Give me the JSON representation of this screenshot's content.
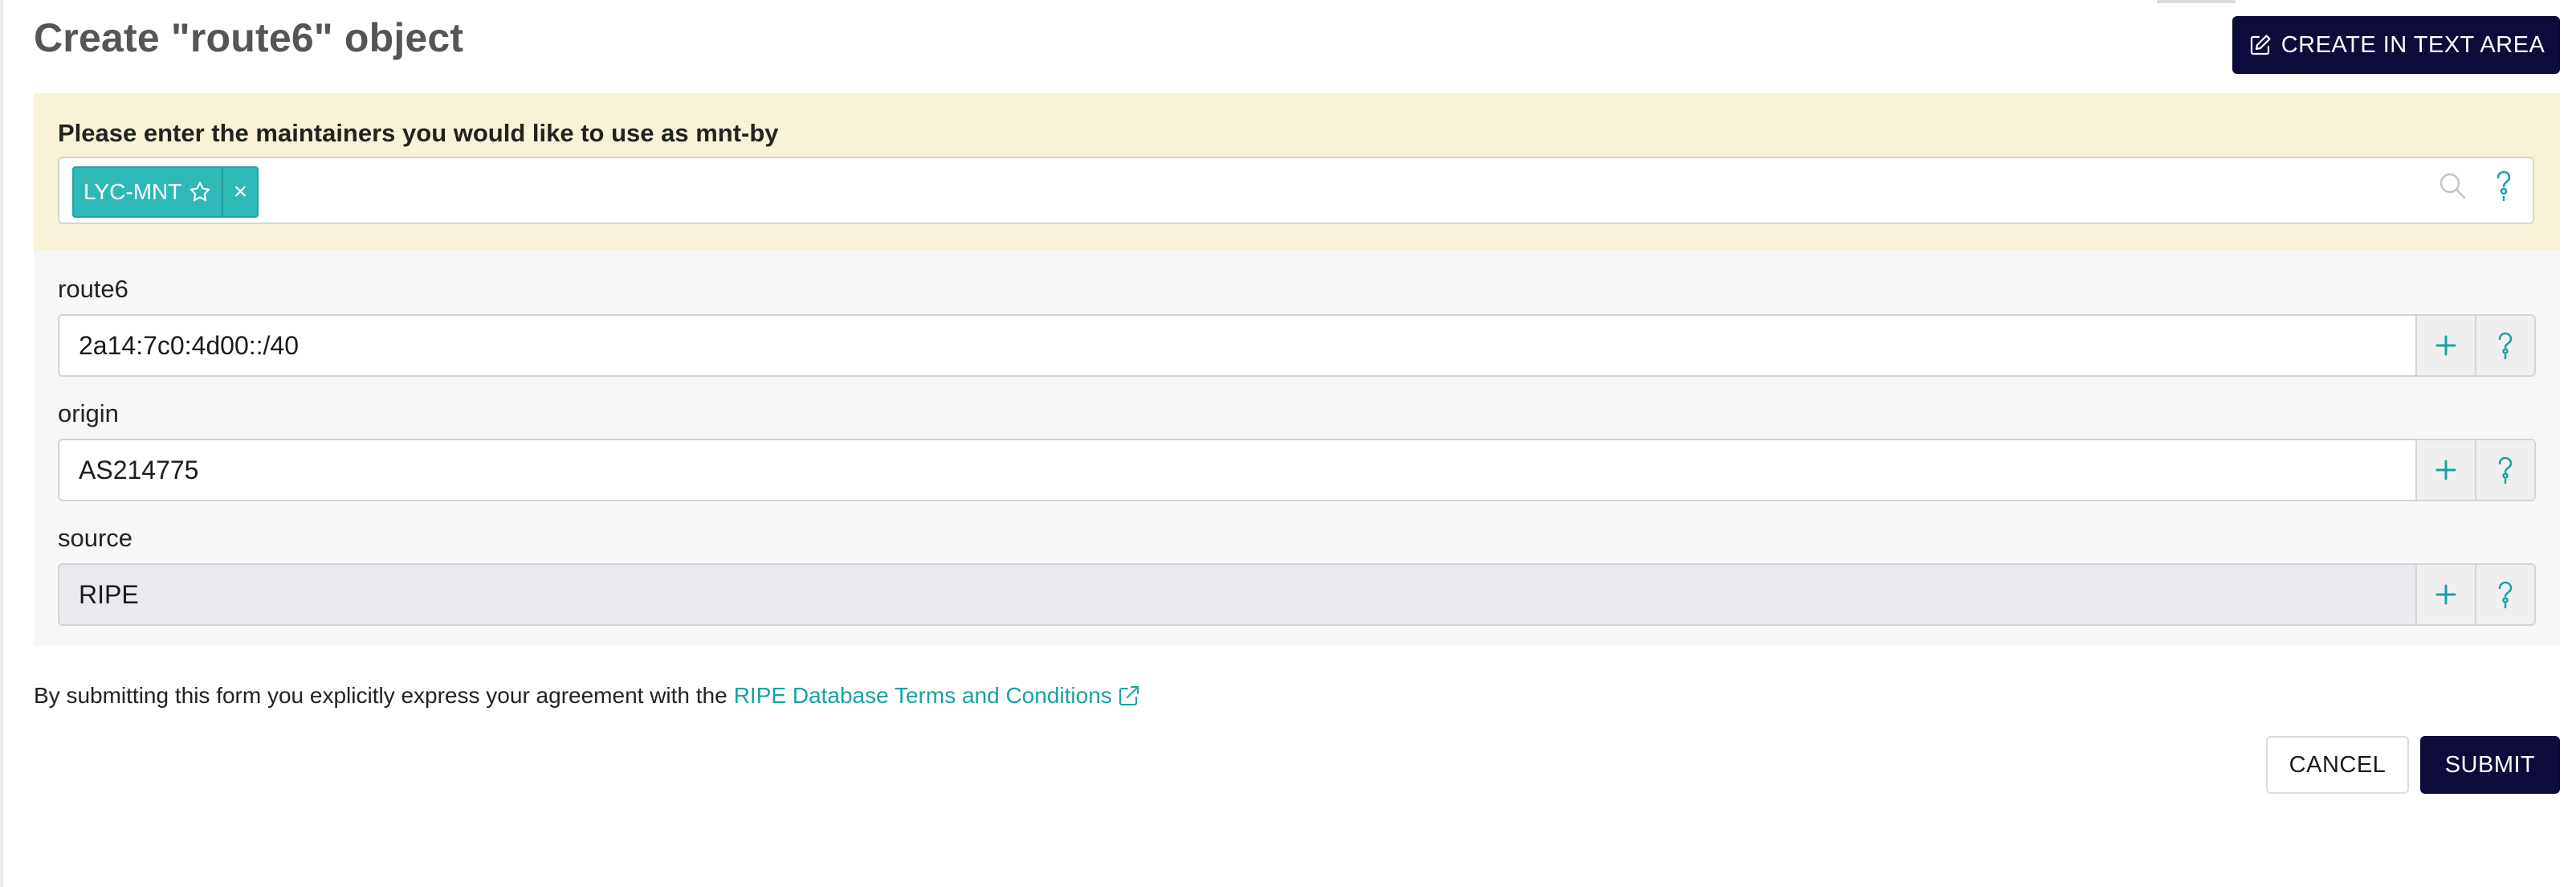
{
  "header": {
    "title": "Create \"route6\" object",
    "text_area_button_label": "CREATE IN TEXT AREA"
  },
  "maintainers": {
    "label": "Please enter the maintainers you would like to use as mnt-by",
    "selected": [
      {
        "name": "LYC-MNT",
        "remove_label": "×"
      }
    ]
  },
  "attributes": [
    {
      "label": "route6",
      "value": "2a14:7c0:4d00::/40",
      "disabled": false
    },
    {
      "label": "origin",
      "value": "AS214775",
      "disabled": false
    },
    {
      "label": "source",
      "value": "RIPE",
      "disabled": true
    }
  ],
  "footer": {
    "agreement_text": "By submitting this form you explicitly express your agreement with the",
    "terms_link_text": "RIPE Database Terms and Conditions",
    "cancel_label": "CANCEL",
    "submit_label": "SUBMIT"
  },
  "icons": {
    "edit": "edit-icon",
    "star": "star-icon",
    "search": "search-icon",
    "help": "help-icon",
    "add": "plus-icon",
    "external_link": "external-link-icon"
  },
  "colors": {
    "primary_dark": "#0d0b3b",
    "teal_accent": "#2eb8b8",
    "maintainer_bg": "#f8f3d8",
    "attributes_bg": "#f7f7f7",
    "disabled_input": "#e8eaed",
    "title_gray": "#555555"
  }
}
